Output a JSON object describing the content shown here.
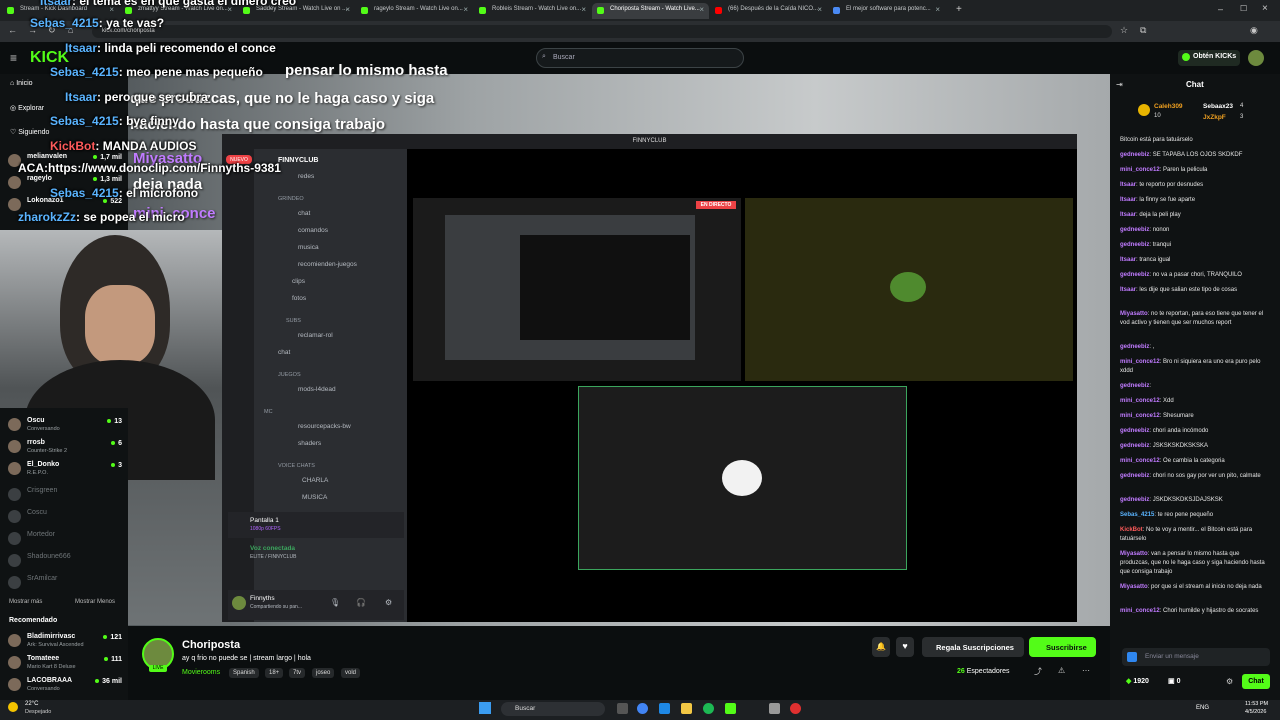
{
  "browser": {
    "tabs": [
      {
        "label": "Stream - Kick Dashboard",
        "active": false
      },
      {
        "label": "zmattyy Stream - Watch Live on...",
        "active": false
      },
      {
        "label": "Saddey Stream - Watch Live on ...",
        "active": false
      },
      {
        "label": "rageylo Stream - Watch Live on...",
        "active": false
      },
      {
        "label": "Robleis Stream - Watch Live on...",
        "active": false
      },
      {
        "label": "Choriposta Stream - Watch Live...",
        "active": true
      },
      {
        "label": "(66) Después de la Caída NICO...",
        "active": false
      },
      {
        "label": "El mejor software para potenc...",
        "active": false
      }
    ],
    "url": "kick.com/choriposta"
  },
  "kick": {
    "logo": "KICK",
    "search_placeholder": "Buscar",
    "get_kicks": "Obtén KICKs"
  },
  "sidebar": {
    "nav": [
      "Inicio",
      "Explorar",
      "Siguiendo"
    ],
    "following": [
      {
        "name": "melianvalen",
        "game": "",
        "viewers": "1,7 mil",
        "live": true
      },
      {
        "name": "rageylo",
        "game": "",
        "viewers": "1,3 mil",
        "live": true
      },
      {
        "name": "Lokonazo1",
        "game": "",
        "viewers": "522",
        "live": true
      },
      {
        "name": "Oscu",
        "game": "Conversando",
        "viewers": "13",
        "live": true
      },
      {
        "name": "rrosb",
        "game": "Counter-Strike 2",
        "viewers": "6",
        "live": true
      },
      {
        "name": "El_Donko",
        "game": "R.E.P.O.",
        "viewers": "3",
        "live": true
      },
      {
        "name": "Crisgreen",
        "game": "",
        "viewers": "",
        "live": false
      },
      {
        "name": "Coscu",
        "game": "",
        "viewers": "",
        "live": false
      },
      {
        "name": "Mortedor",
        "game": "",
        "viewers": "",
        "live": false
      },
      {
        "name": "Shadoune666",
        "game": "",
        "viewers": "",
        "live": false
      },
      {
        "name": "SrAmilcar",
        "game": "",
        "viewers": "",
        "live": false
      }
    ],
    "show_more": "Mostrar más",
    "show_less": "Mostrar Menos",
    "recommended_title": "Recomendado",
    "recommended": [
      {
        "name": "Bladimirrivasc",
        "game": "Ark: Survival Ascended",
        "viewers": "121"
      },
      {
        "name": "Tomateee",
        "game": "Mario Kart 8 Deluxe",
        "viewers": "111"
      },
      {
        "name": "LACOBRAAA",
        "game": "Conversando",
        "viewers": "36 mil"
      }
    ]
  },
  "overlay": {
    "lines": [
      {
        "user": "Itsaar",
        "text": "el tema es en que gasta el dinero creo"
      },
      {
        "user": "Sebas_4215",
        "text": "ya te vas?"
      },
      {
        "user": "Itsaar",
        "text": "linda peli recomendo el conce"
      },
      {
        "user": "Sebas_4215",
        "text": "meo pene mas pequeño"
      },
      {
        "user": "Itsaar",
        "text": "pero que se cubra"
      },
      {
        "user": "Sebas_4215",
        "text": "bye finny"
      },
      {
        "user": "KickBot",
        "text": "MANDA AUDIOS"
      },
      {
        "user": "",
        "text": "ACA:https://www.donoclip.com/Finnyths-9381"
      },
      {
        "user": "Sebas_4215",
        "text": "el microfono"
      },
      {
        "user": "zharokzZz",
        "text": "se popea el micro"
      }
    ],
    "caption1": "pensar lo mismo hasta",
    "caption2": "que produzcas, que no le haga caso y siga",
    "caption3": "haciendo hasta que consiga trabajo",
    "miya": "Miyasatto",
    "deja": "deja nada",
    "mini": "mini_conce"
  },
  "discord": {
    "window_title": "FINNYCLUB",
    "server": "FINNYCLUB",
    "new_badge": "NUEVO",
    "channels": [
      {
        "label": "redes"
      },
      {
        "label": "chat"
      },
      {
        "label": "comandos"
      },
      {
        "label": "musica"
      },
      {
        "label": "recomienden-juegos"
      },
      {
        "label": "clips"
      },
      {
        "label": "fotos"
      },
      {
        "label": "reclamar-rol"
      },
      {
        "label": "chat"
      },
      {
        "label": "mods-l4dead"
      },
      {
        "label": "resourcepacks-bw"
      },
      {
        "label": "shaders"
      },
      {
        "label": "CHARLA"
      },
      {
        "label": "MUSICA"
      }
    ],
    "categories": [
      "GRINDEO",
      "SUBS",
      "JUEGOS",
      "MC",
      "VOICE CHATS"
    ],
    "screen_share": "Pantalla 1",
    "screen_share_sub": "1080p 60FPS",
    "voice_connected": "Voz conectada",
    "voice_channel": "ELITE / FINNYCLUB",
    "user": "Finnyths",
    "user_status": "Compartiendo su pan...",
    "live_badge": "EN DIRECTO"
  },
  "stream_info": {
    "streamer": "Choriposta",
    "title": "ay q frio no  puede se | stream largo  | hola",
    "category": "Movierooms",
    "tags": [
      "Spanish",
      "18+",
      "7tv",
      "joseo",
      "vold"
    ],
    "gift_label": "Regala Suscripciones",
    "subscribe_label": "Suscribirse",
    "viewers": "26",
    "viewers_label": "Espectadores"
  },
  "chat": {
    "title": "Chat",
    "leaderboard": [
      {
        "name": "Caleh309",
        "value": "10"
      },
      {
        "name": "Sebaax23",
        "value": "4"
      },
      {
        "name": "JxZkpF",
        "value": "3"
      }
    ],
    "messages": [
      {
        "user": "",
        "text": "Bitcoin está para tatuárselo",
        "color": "#e6e6e6"
      },
      {
        "user": "gedneebiz",
        "text": "SE TAPABA LOS OJOS SKDKDF",
        "color": "#c07bff"
      },
      {
        "user": "mini_conce12",
        "text": "Paren la pelicula",
        "color": "#c07bff"
      },
      {
        "user": "Itsaar",
        "text": "te reporto por desnudes",
        "color": "#c07bff"
      },
      {
        "user": "Itsaar",
        "text": "la finny se fue aparte",
        "color": "#c07bff"
      },
      {
        "user": "Itsaar",
        "text": "deja la peli play",
        "color": "#c07bff"
      },
      {
        "user": "gedneebiz",
        "text": "nonon",
        "color": "#c07bff"
      },
      {
        "user": "gedneebiz",
        "text": "tranqui",
        "color": "#c07bff"
      },
      {
        "user": "Itsaar",
        "text": "tranca igual",
        "color": "#c07bff"
      },
      {
        "user": "gedneebiz",
        "text": "no va a pasar chori, TRANQUILO",
        "color": "#c07bff"
      },
      {
        "user": "Itsaar",
        "text": "les dije que salian este tipo de cosas",
        "color": "#c07bff"
      },
      {
        "user": "Miyasatto",
        "text": "no te reportan, para eso tiene que tener el vod activo y tienen que ser muchos report",
        "color": "#c07bff"
      },
      {
        "user": "gedneebiz",
        "text": ",",
        "color": "#c07bff"
      },
      {
        "user": "mini_conce12",
        "text": "Bro ni siquiera era uno era puro pelo xddd",
        "color": "#c07bff"
      },
      {
        "user": "gedneebiz",
        "text": "",
        "color": "#c07bff"
      },
      {
        "user": "mini_conce12",
        "text": "Xdd",
        "color": "#c07bff"
      },
      {
        "user": "mini_conce12",
        "text": "Shesumare",
        "color": "#c07bff"
      },
      {
        "user": "gedneebiz",
        "text": "chori anda incómodo",
        "color": "#c07bff"
      },
      {
        "user": "gedneebiz",
        "text": "JSKSKSKDKSKSKA",
        "color": "#c07bff"
      },
      {
        "user": "mini_conce12",
        "text": "Oe cambia la categoria",
        "color": "#c07bff"
      },
      {
        "user": "gedneebiz",
        "text": "chori no sos gay por ver un pito, calmate",
        "color": "#c07bff"
      },
      {
        "user": "gedneebiz",
        "text": "JSKDKSKDKSJDAJSKSK",
        "color": "#c07bff"
      },
      {
        "user": "Sebas_4215",
        "text": "te reo pene pequeño",
        "color": "#5ab4ff"
      },
      {
        "user": "KickBot",
        "text": "No te voy a mentir... el Bitcoin está para tatuárselo",
        "color": "#ff5b5b"
      },
      {
        "user": "Miyasatto",
        "text": "van a pensar lo mismo hasta que produzcas, que no le haga caso y siga haciendo hasta que consiga trabajo",
        "color": "#c07bff"
      },
      {
        "user": "Miyasatto",
        "text": "por que si el stream al inicio no deja nada",
        "color": "#c07bff"
      },
      {
        "user": "mini_conce12",
        "text": "Chori humilde y hijastro de socrates",
        "color": "#c07bff"
      }
    ],
    "input_placeholder": "Enviar un mensaje",
    "points": "1920",
    "other_points": "0",
    "send_label": "Chat"
  },
  "taskbar": {
    "weather_temp": "22°C",
    "weather_text": "Despejado",
    "search": "Buscar",
    "lang": "ENG",
    "time": "11:53 PM",
    "date": "4/5/2026"
  },
  "colors": {
    "accent": "#53fc18",
    "discord_bg": "#2b2d31",
    "live_red": "#ed4245"
  }
}
